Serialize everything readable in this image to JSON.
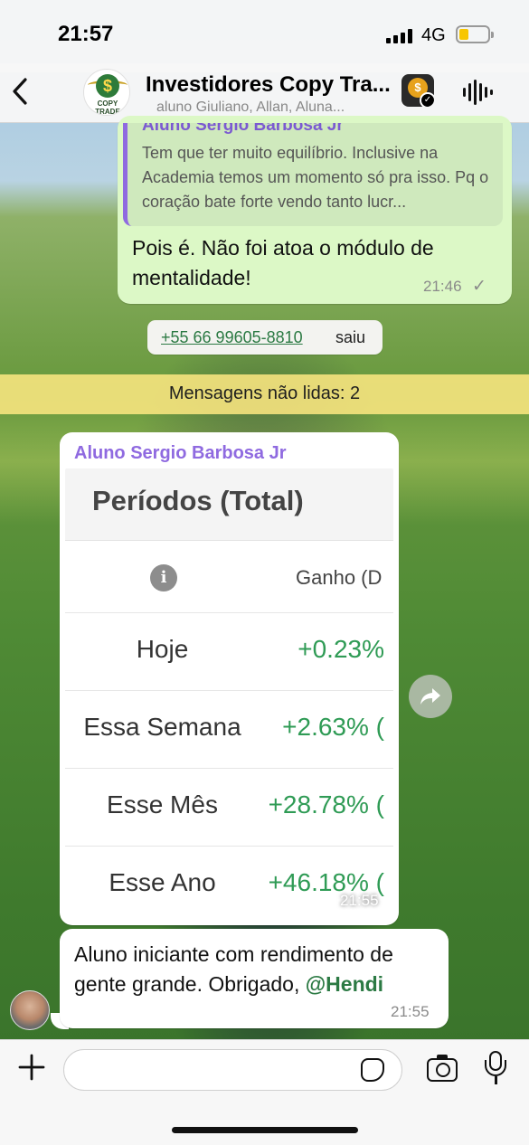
{
  "status_bar": {
    "time": "21:57",
    "network": "4G"
  },
  "header": {
    "title": "Investidores Copy Tra...",
    "subtitle": "aluno Giuliano, Allan, Aluna...",
    "avatar_brand": "COPY TRADE",
    "avatar_symbol": "$",
    "app_icon_symbol": "$"
  },
  "messages": {
    "outgoing_reply": {
      "quoted_author": "Aluno Sergio Barbosa Jr",
      "quoted_text": "Tem que ter muito equilíbrio. Inclusive na Academia temos um momento só pra isso. Pq o coração bate forte vendo tanto lucr...",
      "text": "Pois é. Não foi atoa o módulo de mentalidade!",
      "time": "21:46",
      "status_icon": "✓"
    },
    "system": {
      "phone": "+55 66 99605-8810",
      "action": "saiu"
    },
    "unread_banner": "Mensagens não lidas: 2",
    "image_message": {
      "author": "Aluno Sergio Barbosa Jr",
      "time": "21:55",
      "screenshot": {
        "title": "Períodos (Total)",
        "info_icon": "i",
        "column_header": "Ganho (D",
        "rows": [
          {
            "period": "Hoje",
            "gain": "+0.23%"
          },
          {
            "period": "Essa Semana",
            "gain": "+2.63% ("
          },
          {
            "period": "Esse Mês",
            "gain": "+28.78% ("
          },
          {
            "period": "Esse Ano",
            "gain": "+46.18% ("
          }
        ]
      }
    },
    "text_message": {
      "text_before": "Aluno iniciante com rendimento de gente grande. Obrigado, ",
      "mention": "@Hendi",
      "time": "21:55"
    }
  },
  "composer": {
    "placeholder": ""
  },
  "colors": {
    "outgoing_bubble": "#dcf8c6",
    "incoming_bubble": "#ffffff",
    "author_purple": "#8f6ae0",
    "gain_green": "#2f9b55",
    "mention_green": "#2c7a44",
    "unread_banner": "#ffe982"
  },
  "icons": {
    "back": "chevron-left-icon",
    "audio": "audio-wave-icon",
    "forward": "forward-arrow-icon",
    "plus": "plus-icon",
    "sticker": "sticker-icon",
    "camera": "camera-icon",
    "mic": "microphone-icon"
  }
}
